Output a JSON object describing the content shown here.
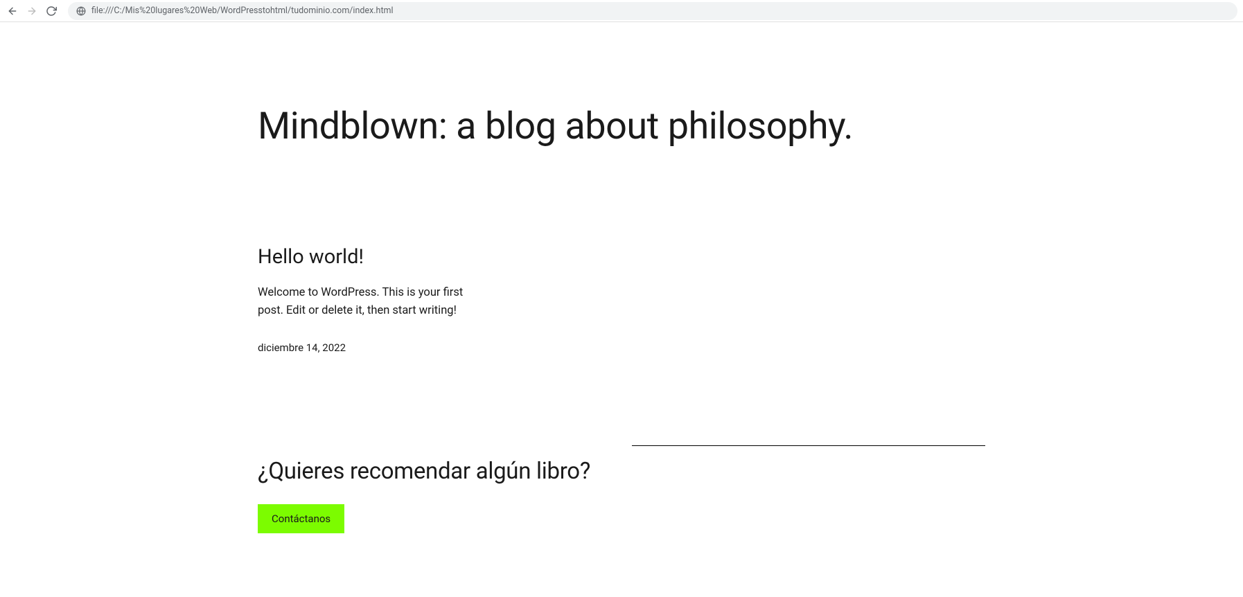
{
  "browser": {
    "url": "file:///C:/Mis%20lugares%20Web/WordPresstohtml/tudominio.com/index.html"
  },
  "page": {
    "title": "Mindblown: a blog about philosophy."
  },
  "post": {
    "title": "Hello world!",
    "excerpt": "Welcome to WordPress. This is your first post. Edit or delete it, then start writing!",
    "date": "diciembre 14, 2022"
  },
  "cta": {
    "title": "¿Quieres recomendar algún libro?",
    "button": "Contáctanos"
  }
}
